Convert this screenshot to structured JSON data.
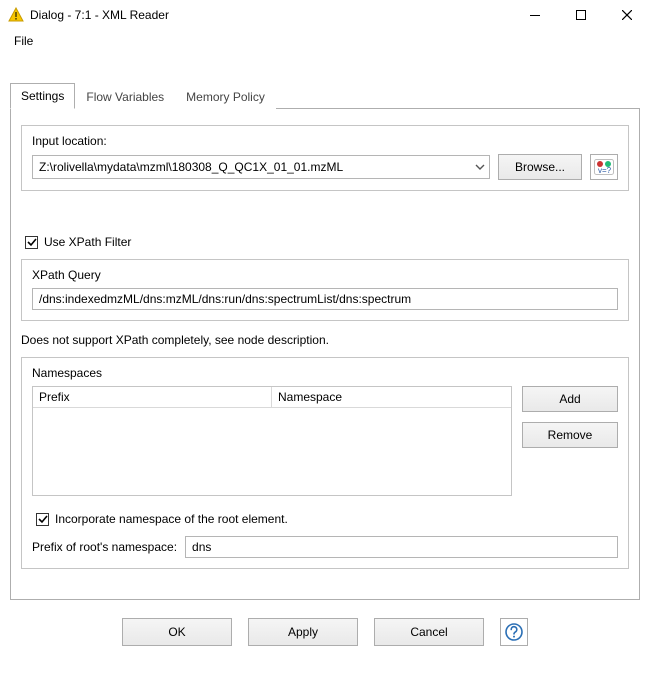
{
  "titlebar": {
    "title": "Dialog - 7:1 - XML Reader"
  },
  "menu": {
    "file": "File"
  },
  "tabs": {
    "settings": "Settings",
    "flow_variables": "Flow Variables",
    "memory_policy": "Memory Policy"
  },
  "settings": {
    "input_location_label": "Input location:",
    "input_location_value": "Z:\\rolivella\\mydata\\mzml\\180308_Q_QC1X_01_01.mzML",
    "browse_label": "Browse...",
    "use_xpath_filter_label": "Use XPath Filter",
    "xpath_query_label": "XPath Query",
    "xpath_query_value": "/dns:indexedmzML/dns:mzML/dns:run/dns:spectrumList/dns:spectrum",
    "xpath_hint": "Does not support XPath completely, see node description.",
    "namespaces_label": "Namespaces",
    "col_prefix": "Prefix",
    "col_namespace": "Namespace",
    "add_label": "Add",
    "remove_label": "Remove",
    "incorporate_ns_label": "Incorporate namespace of the root element.",
    "root_prefix_label": "Prefix of root's namespace:",
    "root_prefix_value": "dns"
  },
  "buttons": {
    "ok": "OK",
    "apply": "Apply",
    "cancel": "Cancel"
  }
}
